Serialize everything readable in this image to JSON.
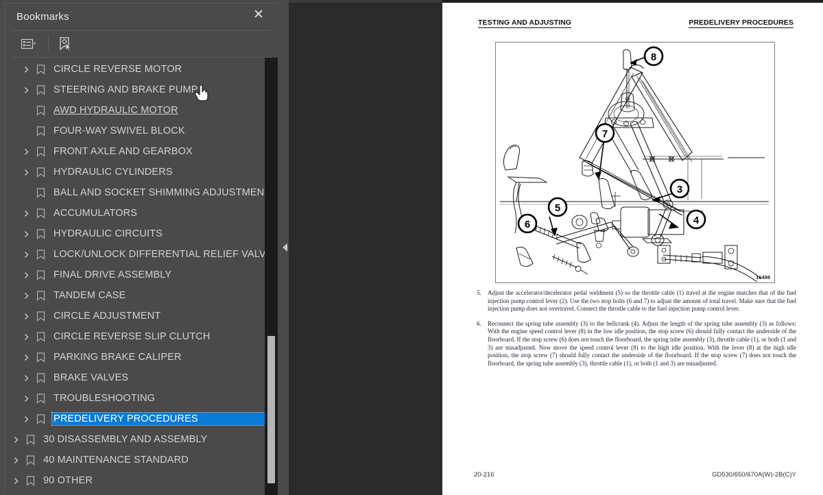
{
  "panel": {
    "title": "Bookmarks",
    "close_icon": "close-icon",
    "toolbar": {
      "list_options_icon": "list-options-icon",
      "list_options_caret": "chevron-down-icon",
      "new_bookmark_icon": "new-bookmark-icon"
    },
    "selected_color": "#0b7ad4",
    "items": [
      {
        "label": "CIRCLE REVERSE MOTOR",
        "level": 2,
        "expandable": true,
        "selected": false,
        "link": false
      },
      {
        "label": "STEERING AND BRAKE PUMP",
        "level": 2,
        "expandable": true,
        "selected": false,
        "link": false
      },
      {
        "label": "AWD HYDRAULIC MOTOR",
        "level": 2,
        "expandable": false,
        "selected": false,
        "link": true
      },
      {
        "label": "FOUR-WAY SWIVEL BLOCK",
        "level": 2,
        "expandable": false,
        "selected": false,
        "link": false
      },
      {
        "label": "FRONT AXLE AND GEARBOX",
        "level": 2,
        "expandable": true,
        "selected": false,
        "link": false
      },
      {
        "label": "HYDRAULIC CYLINDERS",
        "level": 2,
        "expandable": true,
        "selected": false,
        "link": false
      },
      {
        "label": "BALL AND SOCKET SHIMMING ADJUSTMENT",
        "level": 2,
        "expandable": false,
        "selected": false,
        "link": false
      },
      {
        "label": "ACCUMULATORS",
        "level": 2,
        "expandable": true,
        "selected": false,
        "link": false
      },
      {
        "label": "HYDRAULIC CIRCUITS",
        "level": 2,
        "expandable": true,
        "selected": false,
        "link": false
      },
      {
        "label": "LOCK/UNLOCK DIFFERENTIAL RELIEF VALVE",
        "level": 2,
        "expandable": true,
        "selected": false,
        "link": false
      },
      {
        "label": "FINAL DRIVE ASSEMBLY",
        "level": 2,
        "expandable": true,
        "selected": false,
        "link": false
      },
      {
        "label": "TANDEM CASE",
        "level": 2,
        "expandable": true,
        "selected": false,
        "link": false
      },
      {
        "label": "CIRCLE ADJUSTMENT",
        "level": 2,
        "expandable": true,
        "selected": false,
        "link": false
      },
      {
        "label": "CIRCLE REVERSE SLIP CLUTCH",
        "level": 2,
        "expandable": true,
        "selected": false,
        "link": false
      },
      {
        "label": "PARKING BRAKE CALIPER",
        "level": 2,
        "expandable": true,
        "selected": false,
        "link": false
      },
      {
        "label": "BRAKE VALVES",
        "level": 2,
        "expandable": true,
        "selected": false,
        "link": false
      },
      {
        "label": "TROUBLESHOOTING",
        "level": 2,
        "expandable": true,
        "selected": false,
        "link": false
      },
      {
        "label": "PREDELIVERY PROCEDURES",
        "level": 2,
        "expandable": true,
        "selected": true,
        "link": false
      },
      {
        "label": "30 DISASSEMBLY AND ASSEMBLY",
        "level": 1,
        "expandable": true,
        "selected": false,
        "link": false
      },
      {
        "label": "40 MAINTENANCE STANDARD",
        "level": 1,
        "expandable": true,
        "selected": false,
        "link": false
      },
      {
        "label": "90 OTHER",
        "level": 1,
        "expandable": true,
        "selected": false,
        "link": false
      }
    ]
  },
  "viewer": {
    "collapse_arrow_icon": "collapse-left-arrow-icon",
    "cursor_icon": "pointing-hand-cursor"
  },
  "document": {
    "header_left": "TESTING AND ADJUSTING",
    "header_right": "PREDELIVERY PROCEDURES",
    "figure": {
      "id": "16498",
      "callouts": [
        "8",
        "3",
        "5",
        "7",
        "6",
        "4"
      ]
    },
    "paragraphs": [
      {
        "num": "5.",
        "text": "Adjust the accelerator/decelerator pedal weldment (5) so the throttle cable (1) travel at the engine matches that of the fuel injection pump control lever (2). Use the two stop bolts (6 and 7) to adjust the amount of total travel. Make sure that the fuel injection pump does not overtravel. Connect the throttle cable to the fuel injection pump control lever."
      },
      {
        "num": "6.",
        "text": "Reconnect the spring tube assembly (3) to the bellcrank (4). Adjust the length of the spring tube assembly (3) as follows: With the engine speed control lever (8) in the low idle position, the stop screw (6) should fully contact the underside of the floorboard. If the stop screw (6) does not touch the floorboard, the spring tube assembly (3), throttle cable (1), or both (1 and 3) are misadjusted. Now move the speed control lever (8) to the high idle position. With the lever (8) at the high idle position, the stop screw (7) should fully contact the underside of the floorboard. If the stop screw (7) does not touch the floorboard, the spring tube assembly (3), throttle cable (1), or both (1 and 3) are misadjusted."
      }
    ],
    "footer_left": "20-216",
    "footer_right": "GD530/650/670A(W)-2B(C)Y"
  }
}
